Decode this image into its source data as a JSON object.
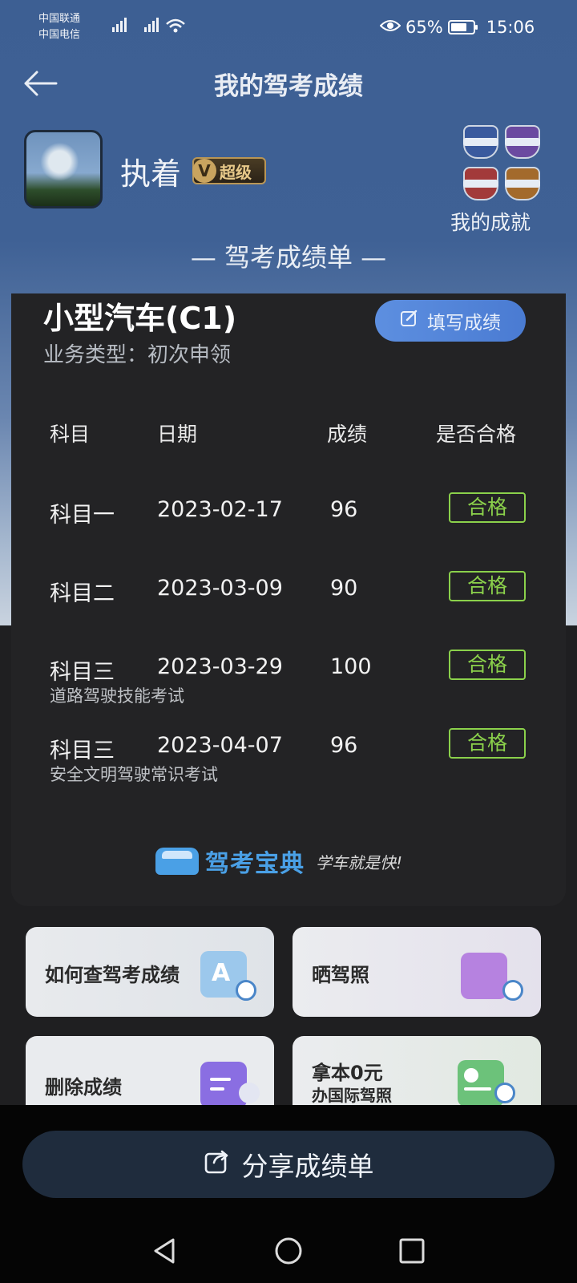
{
  "status_bar": {
    "carrier1": "中国联通",
    "carrier2": "中国电信",
    "signal": "5G 4G",
    "battery": "65%",
    "time": "15:06"
  },
  "header": {
    "title": "我的驾考成绩"
  },
  "profile": {
    "name": "执着",
    "vip_letter": "V",
    "vip_label": "超级",
    "achievements_label": "我的成就"
  },
  "sheet_title": "— 驾考成绩单 —",
  "card": {
    "license": "小型汽车(C1)",
    "business_type": "业务类型：初次申领",
    "fill_button": "填写成绩",
    "columns": [
      "科目",
      "日期",
      "成绩",
      "是否合格"
    ],
    "rows": [
      {
        "subject": "科目一",
        "date": "2023-02-17",
        "score": "96",
        "result": "合格",
        "note": ""
      },
      {
        "subject": "科目二",
        "date": "2023-03-09",
        "score": "90",
        "result": "合格",
        "note": ""
      },
      {
        "subject": "科目三",
        "date": "2023-03-29",
        "score": "100",
        "result": "合格",
        "note": "道路驾驶技能考试"
      },
      {
        "subject": "科目三",
        "date": "2023-04-07",
        "score": "96",
        "result": "合格",
        "note": "安全文明驾驶常识考试"
      }
    ],
    "brand_name": "驾考宝典",
    "brand_slogan": "学车就是快!"
  },
  "tiles": {
    "t1": "如何查驾考成绩",
    "t2": "晒驾照",
    "t3": "删除成绩",
    "t4_line1": "拿本0元",
    "t4_line2": "办国际驾照"
  },
  "share_button": "分享成绩单",
  "colors": {
    "accent": "#4a7bd2",
    "pass": "#8bd14b",
    "header_bg": "#3f6195"
  }
}
